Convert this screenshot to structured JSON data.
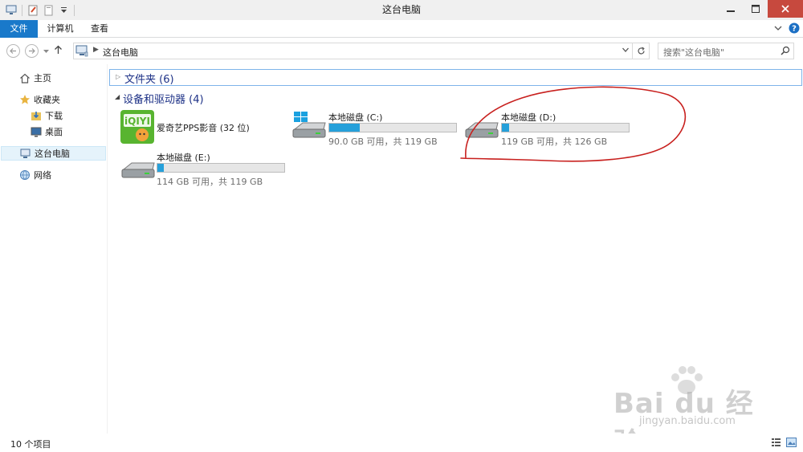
{
  "window": {
    "title": "这台电脑"
  },
  "ribbon": {
    "tabs": [
      "文件",
      "计算机",
      "查看"
    ]
  },
  "address": {
    "crumb": "这台电脑",
    "search_placeholder": "搜索\"这台电脑\""
  },
  "navpane": {
    "items": [
      "主页",
      "收藏夹",
      "下载",
      "桌面",
      "这台电脑",
      "网络"
    ]
  },
  "groups": {
    "folders": "文件夹 (6)",
    "devices": "设备和驱动器 (4)"
  },
  "app_tile": {
    "label": "爱奇艺PPS影音 (32 位)"
  },
  "drives": [
    {
      "name": "本地磁盘 (C:)",
      "info": "90.0 GB 可用，共 119 GB",
      "used_fraction": 0.24
    },
    {
      "name": "本地磁盘 (D:)",
      "info": "119 GB 可用，共 126 GB",
      "used_fraction": 0.06
    },
    {
      "name": "本地磁盘 (E:)",
      "info": "114 GB 可用，共 119 GB",
      "used_fraction": 0.05
    }
  ],
  "statusbar": {
    "count": "10 个项目"
  },
  "watermark": {
    "brand": "Bai du 经验",
    "url": "jingyan.baidu.com"
  },
  "colors": {
    "accent": "#1979ca",
    "drive_bar": "#26a0da",
    "annotation": "#c8201e",
    "group_text": "#1e3287"
  }
}
